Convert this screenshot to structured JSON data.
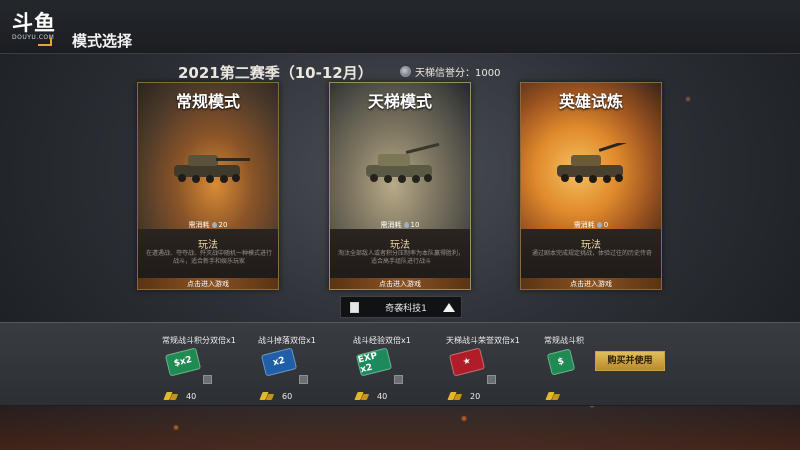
{
  "header": {
    "logo_text": "斗鱼",
    "logo_sub": "DOUYU.COM",
    "title": "模式选择"
  },
  "season": {
    "title": "2021第二赛季（10-12月）",
    "credit_label": "天梯信誉分：1000"
  },
  "modes": [
    {
      "name": "常规模式",
      "cost_label": "需消耗",
      "cost_value": "20",
      "play_label": "玩法",
      "description": "在遭遇战、夺夺战、歼灭战中随机一种模式进行战斗，适合新手和娱乐玩家",
      "enter_label": "点击进入游戏",
      "art_icon": "tank-art-icon"
    },
    {
      "name": "天梯模式",
      "cost_label": "需消耗",
      "cost_value": "10",
      "play_label": "玩法",
      "description": "淘汰全部敌人或者积分压制率为本队赢得胜利，适合高手组队进行战斗",
      "enter_label": "点击进入游戏",
      "art_icon": "tank-art-icon"
    },
    {
      "name": "英雄试炼",
      "cost_label": "需消耗",
      "cost_value": "0",
      "play_label": "玩法",
      "description": "通过剧本完成规定挑战，体验过往的历史传奇",
      "enter_label": "点击进入游戏",
      "art_icon": "tank-art-icon"
    }
  ],
  "selector": {
    "label": "奇袭科技1",
    "icon": "document-icon",
    "arrow_icon": "triangle-up-icon"
  },
  "items": [
    {
      "name": "常规战斗积分双倍x1",
      "ticket": "$x2",
      "price": "40",
      "color": "#1f8a52"
    },
    {
      "name": "战斗掉落双倍x1",
      "ticket": "x2",
      "price": "60",
      "color": "#1f5fa8"
    },
    {
      "name": "战斗经验双倍x1",
      "ticket": "EXP x2",
      "price": "40",
      "color": "#1d8a5c"
    },
    {
      "name": "天梯战斗荣誉双倍x1",
      "ticket": "★",
      "price": "20",
      "color": "#b01c28"
    },
    {
      "name": "常规战斗积",
      "ticket": "$",
      "price": "",
      "color": "#1f8a52"
    }
  ],
  "buy_button": "购买并使用",
  "colors": {
    "accent_gold": "#c8a34b",
    "card_border": "#8a6a3c"
  }
}
